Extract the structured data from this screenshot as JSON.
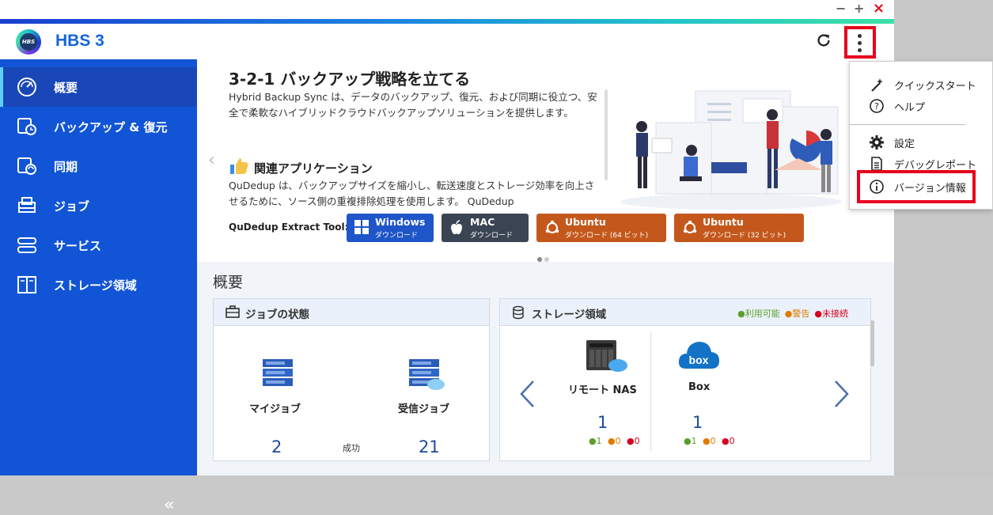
{
  "app": {
    "title": "HBS 3",
    "logo_text": "HBS"
  },
  "window_controls": {
    "minimize": "−",
    "maximize": "+",
    "close": "×"
  },
  "sidebar": {
    "items": [
      {
        "label": "概要",
        "icon": "dashboard-icon",
        "active": true
      },
      {
        "label": "バックアップ & 復元",
        "icon": "backup-restore-icon"
      },
      {
        "label": "同期",
        "icon": "sync-icon"
      },
      {
        "label": "ジョブ",
        "icon": "job-icon"
      },
      {
        "label": "サービス",
        "icon": "service-icon"
      },
      {
        "label": "ストレージ領域",
        "icon": "storage-icon"
      }
    ],
    "collapse_label": "«"
  },
  "banner": {
    "heading": "3-2-1 バックアップ戦略を立てる",
    "text": "Hybrid Backup Sync は、データのバックアップ、復元、および同期に役立つ、安全で柔軟なハイブリッドクラウドバックアップソリューションを提供します。",
    "apps_heading": "関連アプリケーション",
    "apps_text": "QuDedup は、バックアップサイズを縮小し、転送速度とストレージ効率を向上させるために、ソース側の重複排除処理を使用します。 QuDedup",
    "tool_label": "QuDedup Extract Tool:",
    "buttons": [
      {
        "os": "Windows",
        "sub": "ダウンロード",
        "color": "#1e55c8"
      },
      {
        "os": "MAC",
        "sub": "ダウンロード",
        "color": "#3b4452"
      },
      {
        "os": "Ubuntu",
        "sub": "ダウンロード (64 ビット)",
        "color": "#c4581c"
      },
      {
        "os": "Ubuntu",
        "sub": "ダウンロード (32 ビット)",
        "color": "#c4581c"
      }
    ]
  },
  "overview": {
    "title": "概要",
    "jobs_card": {
      "title": "ジョブの状態",
      "my_jobs": "マイジョブ",
      "received_jobs": "受信ジョブ",
      "my_jobs_count": "2",
      "status_label": "成功",
      "received_count": "21"
    },
    "storage_card": {
      "title": "ストレージ領域",
      "legend": {
        "available": "●利用可能",
        "warning": "●警告",
        "disconnected": "●未接続"
      },
      "items": [
        {
          "name": "リモート NAS",
          "count": "1",
          "ok": "1",
          "warn": "0",
          "err": "0"
        },
        {
          "name": "Box",
          "count": "1",
          "ok": "1",
          "warn": "0",
          "err": "0"
        }
      ]
    }
  },
  "menu": {
    "items": [
      {
        "label": "クイックスタート",
        "icon": "magic-wand-icon"
      },
      {
        "label": "ヘルプ",
        "icon": "help-icon"
      },
      {
        "label": "設定",
        "icon": "gear-icon"
      },
      {
        "label": "デバッグレポート",
        "icon": "document-icon"
      },
      {
        "label": "バージョン情報",
        "icon": "info-icon"
      }
    ]
  },
  "colors": {
    "sidebar": "#1155d6",
    "accent": "#1565d8",
    "highlight": "#e8001c",
    "ok": "#5a9e2c",
    "warn": "#e07b00",
    "err": "#d4001c"
  }
}
